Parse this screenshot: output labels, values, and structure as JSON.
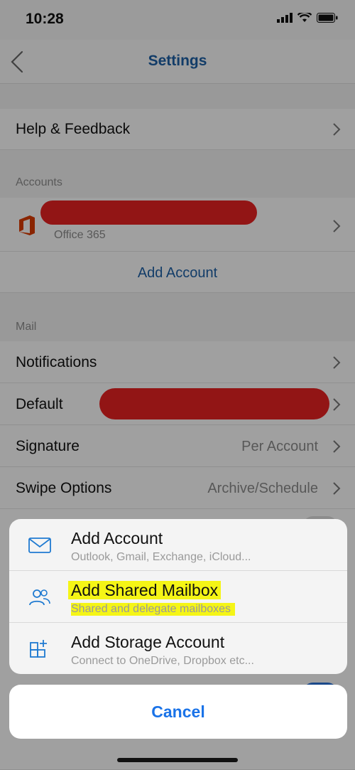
{
  "status_bar": {
    "time": "10:28"
  },
  "nav": {
    "title": "Settings"
  },
  "settings": {
    "help_label": "Help & Feedback",
    "accounts_header": "Accounts",
    "account_sub": "Office 365",
    "add_account_link": "Add Account",
    "mail_header": "Mail",
    "notifications_label": "Notifications",
    "default_label": "Default",
    "signature_label": "Signature",
    "signature_value": "Per Account",
    "swipe_label": "Swipe Options",
    "swipe_value": "Archive/Schedule"
  },
  "action_sheet": {
    "items": [
      {
        "title": "Add Account",
        "subtitle": "Outlook, Gmail, Exchange, iCloud...",
        "icon": "mail-icon"
      },
      {
        "title": "Add Shared Mailbox",
        "subtitle": "Shared and delegate mailboxes",
        "icon": "people-icon"
      },
      {
        "title": "Add Storage Account",
        "subtitle": "Connect to OneDrive, Dropbox etc...",
        "icon": "storage-grid-icon"
      }
    ],
    "cancel_label": "Cancel"
  },
  "colors": {
    "accent": "#1a73e8",
    "highlight": "#f5f516",
    "redaction": "#e42222"
  }
}
